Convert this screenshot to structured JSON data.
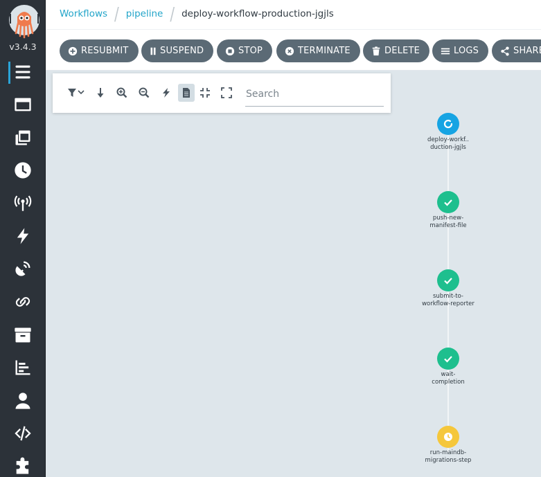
{
  "app": {
    "version": "v3.4.3"
  },
  "sidebar": {
    "items": [
      {
        "name": "workflows",
        "icon": "list-icon",
        "active": true
      },
      {
        "name": "workflow-templates",
        "icon": "window-icon"
      },
      {
        "name": "cluster-workflow-templates",
        "icon": "clone-icon"
      },
      {
        "name": "cron-workflows",
        "icon": "clock-icon"
      },
      {
        "name": "event-sources",
        "icon": "broadcast-tower-icon"
      },
      {
        "name": "sensors",
        "icon": "bolt-icon"
      },
      {
        "name": "event-flow",
        "icon": "satellite-dish-icon"
      },
      {
        "name": "event-bindings",
        "icon": "link-icon"
      },
      {
        "name": "archived-workflows",
        "icon": "archive-icon"
      },
      {
        "name": "reports",
        "icon": "chart-bar-icon"
      },
      {
        "name": "user",
        "icon": "user-icon"
      },
      {
        "name": "api-docs",
        "icon": "code-icon"
      },
      {
        "name": "plugins",
        "icon": "puzzle-piece-icon"
      }
    ]
  },
  "breadcrumb": {
    "items": [
      "Workflows",
      "pipeline"
    ],
    "current": "deploy-workflow-production-jgjls"
  },
  "actions": {
    "resubmit": "RESUBMIT",
    "suspend": "SUSPEND",
    "stop": "STOP",
    "terminate": "TERMINATE",
    "delete": "DELETE",
    "logs": "LOGS",
    "share": "SHARE"
  },
  "toolbar": {
    "tools": [
      "filter-icon",
      "arrow-down-icon",
      "zoom-in-icon",
      "zoom-out-icon",
      "bolt-icon",
      "file-icon",
      "compress-icon",
      "expand-icon"
    ],
    "search_placeholder": "Search"
  },
  "graph": {
    "nodes": [
      {
        "label_line1": "deploy-workf..",
        "label_line2": "duction-jgjls",
        "status": "running"
      },
      {
        "label_line1": "push-new-",
        "label_line2": "manifest-file",
        "status": "succeeded"
      },
      {
        "label_line1": "submit-to-",
        "label_line2": "workflow-reporter",
        "status": "succeeded"
      },
      {
        "label_line1": "wait-",
        "label_line2": "completion",
        "status": "succeeded"
      },
      {
        "label_line1": "run-maindb-",
        "label_line2": "migrations-step",
        "status": "pending"
      }
    ]
  },
  "colors": {
    "sidebar_bg": "#2c3239",
    "accent": "#23a5c9",
    "button_bg": "#5b6a75",
    "running": "#16a4e3",
    "succeeded": "#1ebf8e",
    "pending": "#f5c73b"
  }
}
